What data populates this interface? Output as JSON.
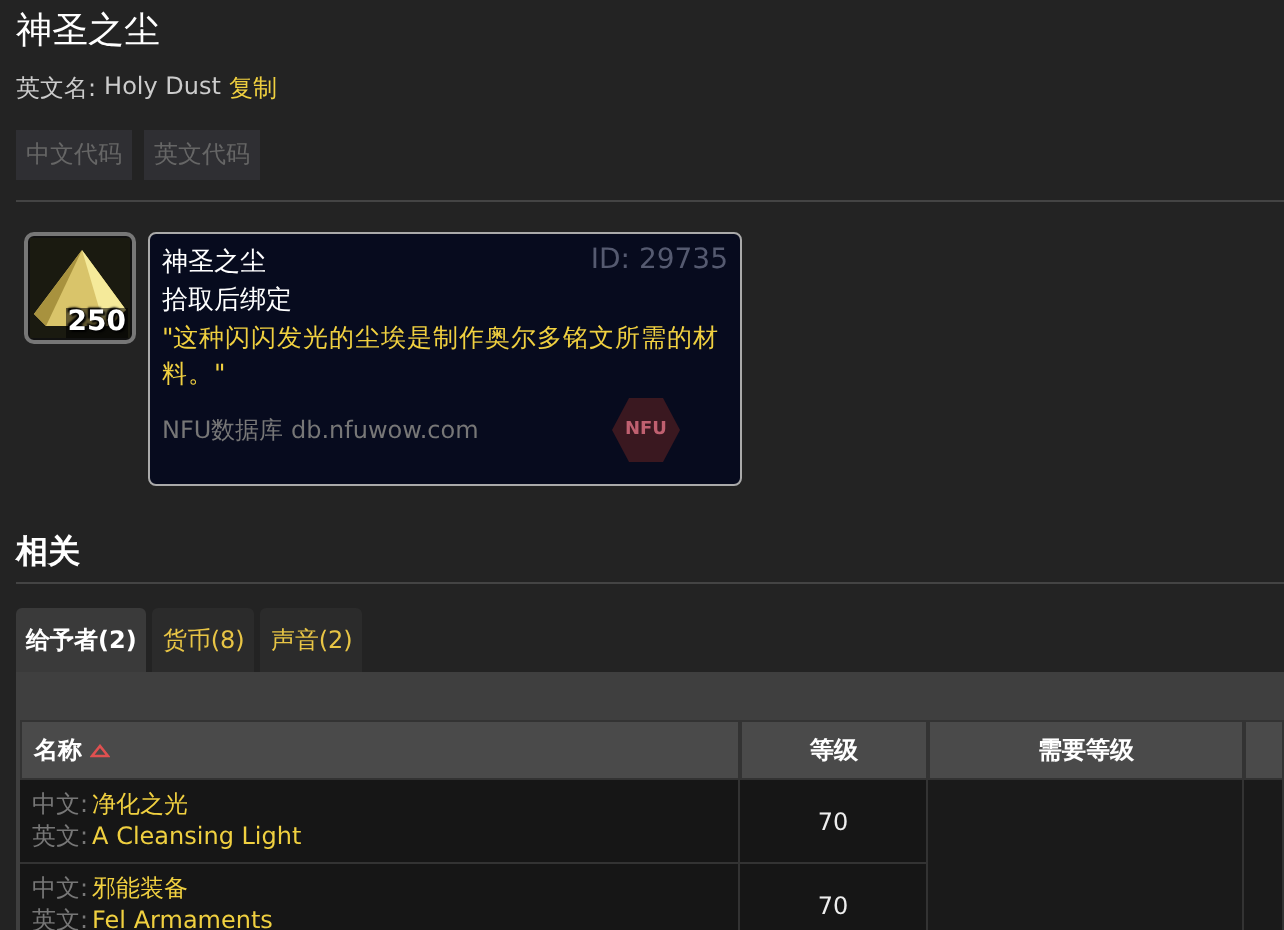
{
  "title": "神圣之尘",
  "english_name": {
    "label": "英文名:",
    "value": "Holy Dust",
    "copy": "复制"
  },
  "code_buttons": [
    "中文代码",
    "英文代码"
  ],
  "item": {
    "count": "250",
    "name": "神圣之尘",
    "id": "ID: 29735",
    "binding": "拾取后绑定",
    "flavor": "\"这种闪闪发光的尘埃是制作奥尔多铭文所需的材料。\"",
    "source": "NFU数据库 db.nfuwow.com",
    "logo": "NFU"
  },
  "section_title": "相关",
  "tabs": [
    {
      "label": "给予者(2)",
      "selected": true
    },
    {
      "label": "货币(8)",
      "selected": false
    },
    {
      "label": "声音(2)",
      "selected": false
    }
  ],
  "table": {
    "columns": [
      {
        "label": "名称",
        "sorted": true
      },
      {
        "label": "等级",
        "sorted": false
      },
      {
        "label": "需要等级",
        "sorted": false
      },
      {
        "sorted": false
      }
    ],
    "rows": [
      {
        "cn_label": "中文:",
        "name_cn": "净化之光",
        "en_label": "英文:",
        "name_en": "A Cleansing Light",
        "level": "70"
      },
      {
        "cn_label": "中文:",
        "name_cn": "邪能装备",
        "en_label": "英文:",
        "name_en": "Fel Armaments",
        "level": "70"
      }
    ]
  }
}
